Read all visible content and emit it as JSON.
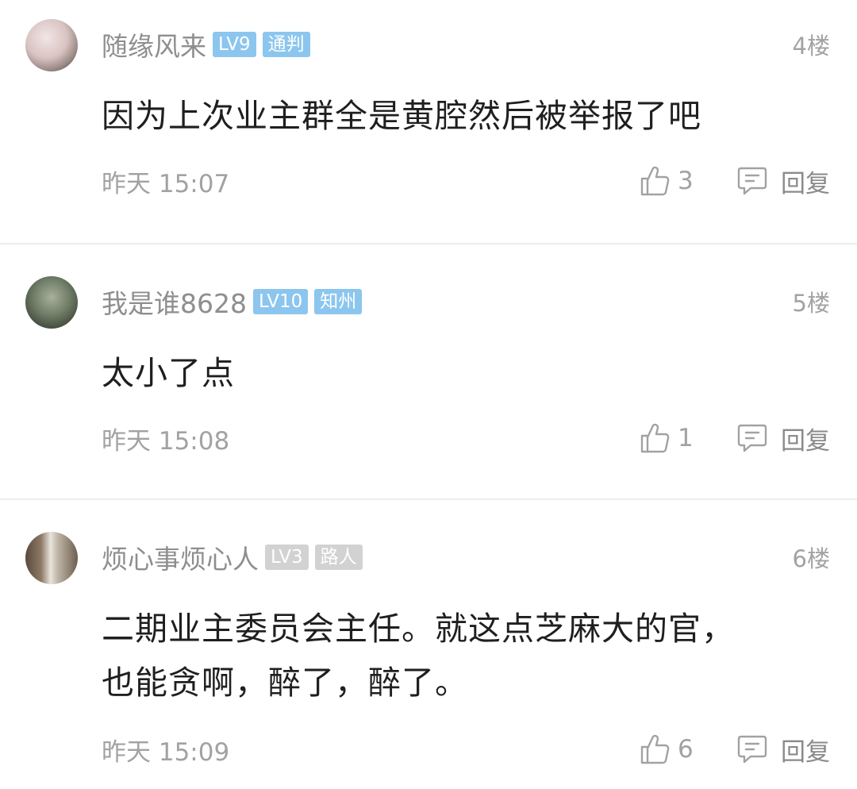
{
  "comments": [
    {
      "username": "随缘风来",
      "level": "LV9",
      "title_badge": "通判",
      "floor": "4楼",
      "text": "因为上次业主群全是黄腔然后被举报了吧",
      "time": "昨天 15:07",
      "likes": "3",
      "reply_label": "回复",
      "badge_colors": [
        "#8cc6ee",
        "#8cc6ee"
      ]
    },
    {
      "username": "我是谁8628",
      "level": "LV10",
      "title_badge": "知州",
      "floor": "5楼",
      "text": "太小了点",
      "time": "昨天 15:08",
      "likes": "1",
      "reply_label": "回复",
      "badge_colors": [
        "#8cc6ee",
        "#8cc6ee"
      ]
    },
    {
      "username": "烦心事烦心人",
      "level": "LV3",
      "title_badge": "路人",
      "floor": "6楼",
      "text_lines": [
        "二期业主委员会主任。就这点芝麻大的官，",
        "也能贪啊，醉了，醉了。"
      ],
      "time": "昨天 15:09",
      "likes": "6",
      "reply_label": "回复",
      "badge_colors": [
        "#d2d2d2",
        "#d2d2d2"
      ]
    }
  ],
  "icons": {
    "like": "thumbs-up-icon",
    "reply": "reply-bubble-icon"
  },
  "colors": {
    "username": "#8e8e8e",
    "meta": "#a2a2a2",
    "badge_blue": "#8cc6ee",
    "badge_grey": "#d2d2d2",
    "divider": "#ececec"
  }
}
